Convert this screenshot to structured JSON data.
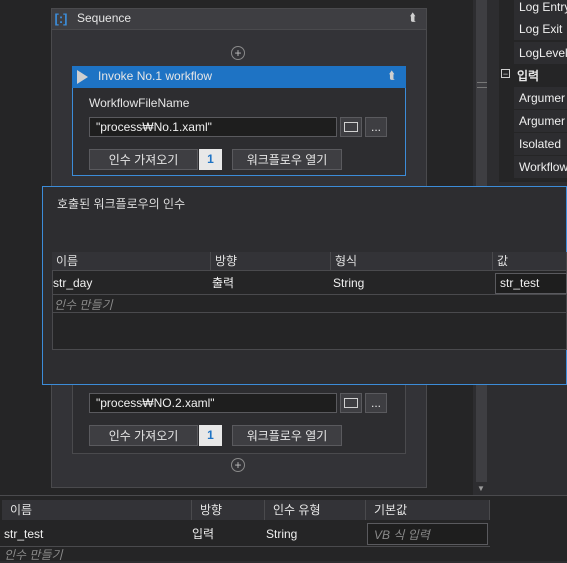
{
  "sequence": {
    "title": "Sequence",
    "collapse_icon": "double-chevron-up"
  },
  "invoke1": {
    "title": "Invoke No.1 workflow",
    "field_label": "WorkflowFileName",
    "file_value": "\"process₩No.1.xaml\"",
    "browse_label": "...",
    "import_args_label": "인수 가져오기",
    "arg_count": "1",
    "open_workflow_label": "워크플로우 열기"
  },
  "invoke2": {
    "file_value": "\"process₩NO.2.xaml\"",
    "browse_label": "...",
    "import_args_label": "인수 가져오기",
    "arg_count": "1",
    "open_workflow_label": "워크플로우 열기"
  },
  "dialog": {
    "title": "호출된 워크플로우의 인수",
    "columns": [
      "이름",
      "방향",
      "형식",
      "값"
    ],
    "row": {
      "name": "str_day",
      "direction": "출력",
      "type": "String",
      "value": "str_test"
    },
    "create_hint": "인수 만들기"
  },
  "properties": {
    "items": [
      "Log Entry",
      "Log Exit",
      "LogLevel"
    ],
    "section": "입력",
    "input_items": [
      "Argumer",
      "Argumer",
      "Isolated",
      "Workflow"
    ]
  },
  "variables": {
    "columns": [
      "이름",
      "방향",
      "인수 유형",
      "기본값"
    ],
    "row": {
      "name": "str_test",
      "direction": "입력",
      "type": "String",
      "default_placeholder": "VB 식 입력"
    },
    "create_hint": "인수 만들기"
  },
  "colors": {
    "accent": "#1e73c4",
    "border_accent": "#3c8cd8",
    "background": "#252526"
  }
}
